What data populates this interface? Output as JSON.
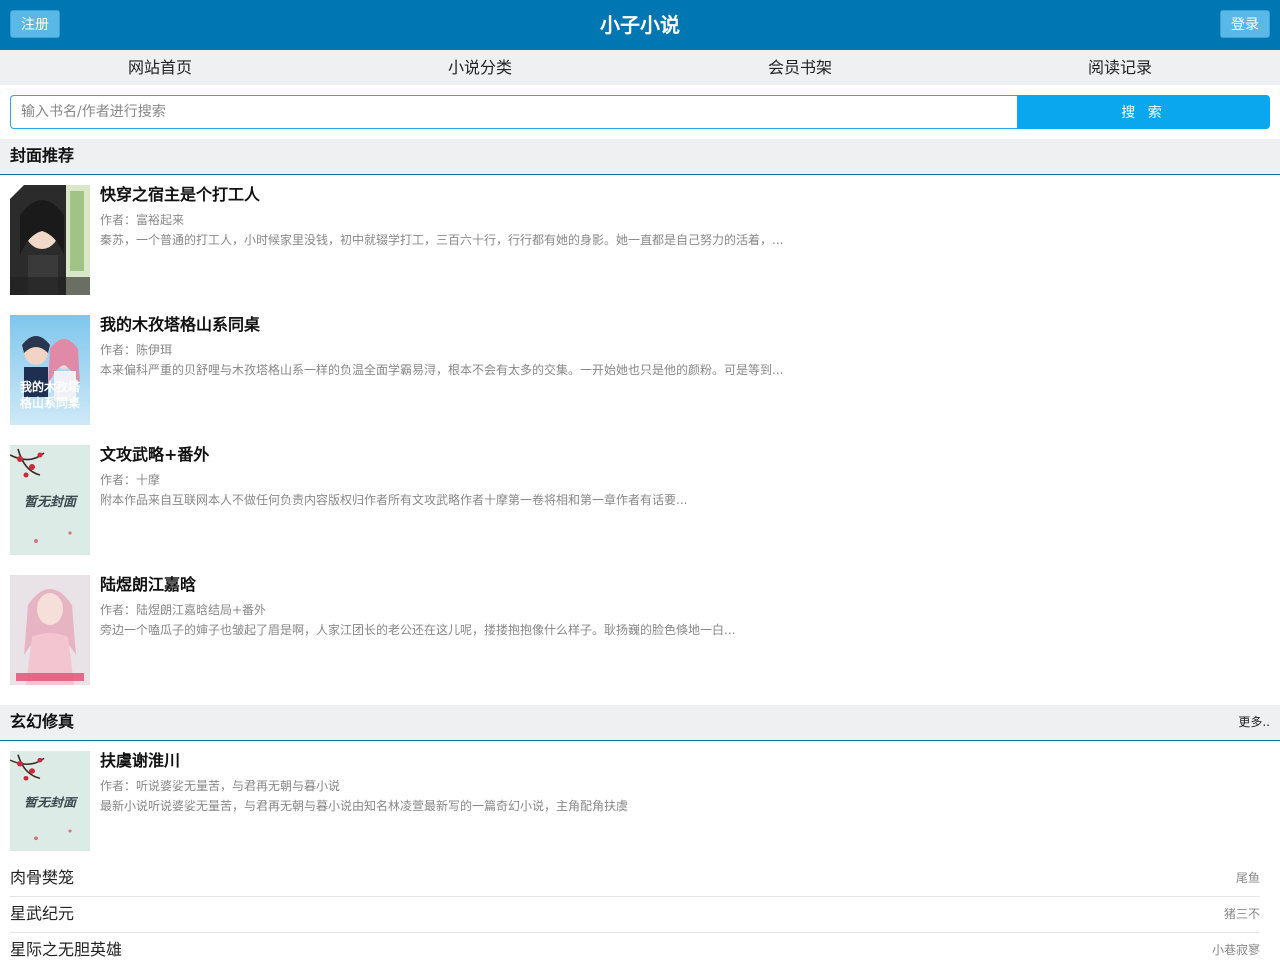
{
  "header": {
    "register_label": "注册",
    "title": "小子小说",
    "login_label": "登录"
  },
  "nav": [
    {
      "label": "网站首页"
    },
    {
      "label": "小说分类"
    },
    {
      "label": "会员书架"
    },
    {
      "label": "阅读记录"
    }
  ],
  "search": {
    "placeholder": "输入书名/作者进行搜索",
    "button_label": "搜 索"
  },
  "featured": {
    "title": "封面推荐",
    "books": [
      {
        "title": "快穿之宿主是个打工人",
        "author": "作者：富裕起来",
        "desc": "秦苏，一个普通的打工人，小时候家里没钱，初中就辍学打工，三百六十行，行行都有她的身影。她一直都是自己努力的活着，..."
      },
      {
        "title": "我的木孜塔格山系同桌",
        "author": "作者：陈伊珥",
        "desc": "本来偏科严重的贝舒哩与木孜塔格山系一样的负温全面学霸易浔，根本不会有太多的交集。一开始她也只是他的颜粉。可是等到..."
      },
      {
        "title": "文攻武略+番外",
        "author": "作者：十摩",
        "desc": "附本作品来自互联网本人不做任何负责内容版权归作者所有文攻武略作者十摩第一卷将相和第一章作者有话要..."
      },
      {
        "title": "陆煜朗江嘉晗",
        "author": "作者：陆煜朗江嘉晗结局+番外",
        "desc": "旁边一个嗑瓜子的婶子也皱起了眉是啊，人家江团长的老公还在这儿呢，搂搂抱抱像什么样子。耿扬巍的脸色倏地一白..."
      }
    ]
  },
  "xuanhuan": {
    "title": "玄幻修真",
    "more_label": "更多..",
    "top_book": {
      "title": "扶虞谢淮川",
      "author": "作者：听说婆娑无量苦，与君再无朝与暮小说",
      "desc": "最新小说听说婆娑无量苦，与君再无朝与暮小说由知名林凌萱最新写的一篇奇幻小说，主角配角扶虞"
    },
    "list": [
      {
        "title": "肉骨樊笼",
        "author": "尾鱼"
      },
      {
        "title": "星武纪元",
        "author": "猪三不"
      },
      {
        "title": "星际之无胆英雄",
        "author": "小巷寂寥"
      }
    ]
  },
  "covers": {
    "placeholder_text": "暂无封面",
    "cover2_text": "我的木孜塔格山系同桌"
  }
}
